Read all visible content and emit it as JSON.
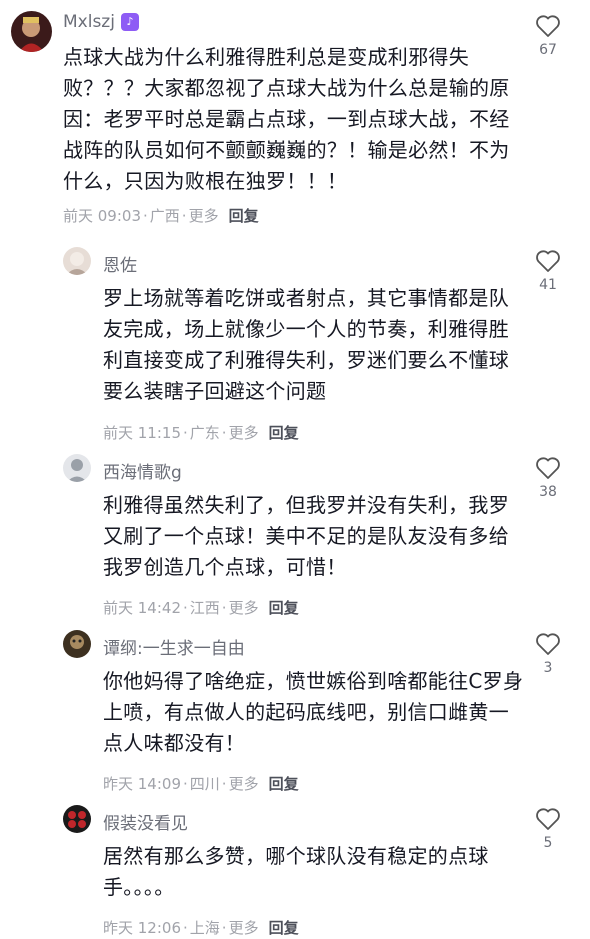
{
  "comments": [
    {
      "user": "Mxlszj",
      "badge": "♪",
      "text": "点球大战为什么利雅得胜利总是变成利邪得失败？？？大家都忽视了点球大战为什么总是输的原因：老罗平时总是霸占点球，一到点球大战，不经战阵的队员如何不颤颤巍巍的？！输是必然！不为什么，只因为败根在独罗！！！",
      "time": "前天 09:03",
      "location": "广西",
      "more": "更多",
      "reply": "回复",
      "likes": "67",
      "avatar_color": "#7a2a2a"
    },
    {
      "user": "恩佐",
      "text": "罗上场就等着吃饼或者射点，其它事情都是队友完成，场上就像少一个人的节奏，利雅得胜利直接变成了利雅得失利，罗迷们要么不懂球要么装瞎子回避这个问题",
      "time": "前天 11:15",
      "location": "广东",
      "more": "更多",
      "reply": "回复",
      "likes": "41",
      "avatar_color": "#c9b9b0"
    },
    {
      "user": "西海情歌g",
      "text": "利雅得虽然失利了，但我罗并没有失利，我罗又刷了一个点球！美中不足的是队友没有多给我罗创造几个点球，可惜！",
      "time": "前天 14:42",
      "location": "江西",
      "more": "更多",
      "reply": "回复",
      "likes": "38",
      "avatar_color": "#cfd3d8"
    },
    {
      "user": "谭纲:一生求一自由",
      "text": "你他妈得了啥绝症，愤世嫉俗到啥都能往C罗身上喷，有点做人的起码底线吧，别信口雌黄一点人味都没有！",
      "time": "昨天 14:09",
      "location": "四川",
      "more": "更多",
      "reply": "回复",
      "likes": "3",
      "avatar_color": "#5a4632"
    },
    {
      "user": "假装没看见",
      "text": "居然有那么多赞，哪个球队没有稳定的点球手。。。。",
      "time": "昨天 12:06",
      "location": "上海",
      "more": "更多",
      "reply": "回复",
      "likes": "5",
      "avatar_color": "#8a1c1c"
    }
  ],
  "icons": {
    "like": "heart-outline-icon"
  }
}
